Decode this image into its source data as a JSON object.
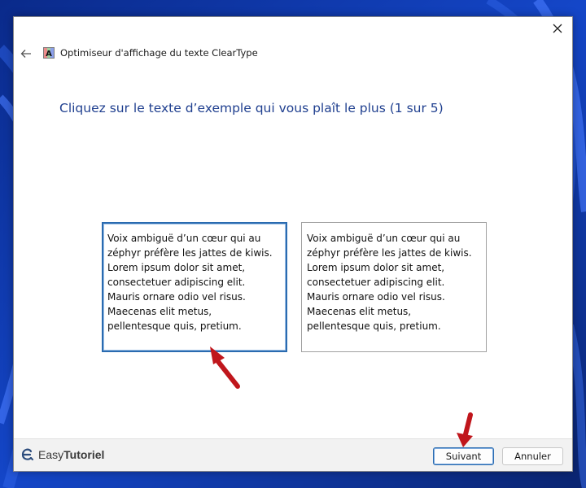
{
  "window": {
    "title": "Optimiseur d'affichage du texte ClearType",
    "close_icon": "close-icon",
    "back_icon": "back-arrow-icon",
    "app_icon": "cleartype-app-icon"
  },
  "main": {
    "heading": "Cliquez sur le texte d’exemple qui vous plaît le plus (1 sur 5)",
    "samples": [
      {
        "text": "Voix ambiguë d’un cœur qui au\nzéphyr préfère les jattes de kiwis.\nLorem ipsum dolor sit amet,\nconsectetuer adipiscing elit.\nMauris ornare odio vel risus.\nMaecenas elit metus,\npellentesque quis, pretium.",
        "selected": true
      },
      {
        "text": "Voix ambiguë d’un cœur qui au\nzéphyr préfère les jattes de kiwis.\nLorem ipsum dolor sit amet,\nconsectetuer adipiscing elit.\nMauris ornare odio vel risus.\nMaecenas elit metus,\npellentesque quis, pretium.",
        "selected": false
      }
    ]
  },
  "footer": {
    "brand_prefix": "Easy",
    "brand_suffix": "Tutoriel",
    "next_label": "Suivant",
    "cancel_label": "Annuler"
  },
  "colors": {
    "heading": "#1f3f8f",
    "selection_border": "#2a6bb0",
    "annotation_arrow": "#c0161c",
    "wallpaper": "#0b2f8f"
  }
}
